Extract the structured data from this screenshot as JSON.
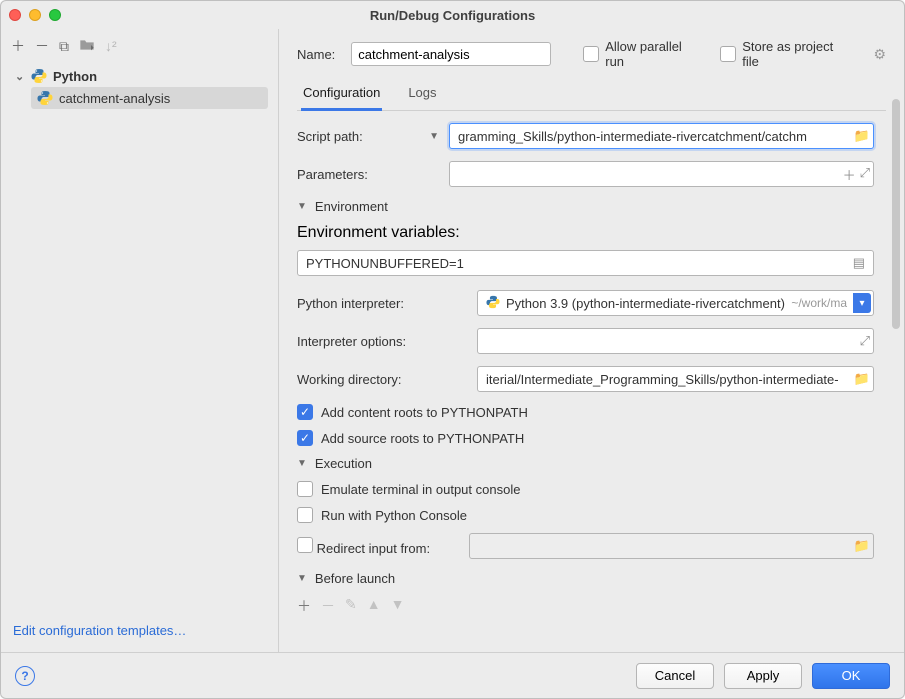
{
  "window": {
    "title": "Run/Debug Configurations"
  },
  "tree": {
    "root_label": "Python",
    "child_label": "catchment-analysis"
  },
  "left_footer": {
    "edit_templates": "Edit configuration templates…"
  },
  "header": {
    "name_label": "Name:",
    "name_value": "catchment-analysis",
    "allow_parallel": "Allow parallel run",
    "store_as_project": "Store as project file"
  },
  "tabs": {
    "configuration": "Configuration",
    "logs": "Logs"
  },
  "form": {
    "script_path_label": "Script path:",
    "script_path_value": "gramming_Skills/python-intermediate-rivercatchment/catchm",
    "parameters_label": "Parameters:",
    "parameters_value": "",
    "env_section": "Environment",
    "env_vars_label": "Environment variables:",
    "env_vars_value": "PYTHONUNBUFFERED=1",
    "interpreter_label": "Python interpreter:",
    "interpreter_value": "Python 3.9 (python-intermediate-rivercatchment)",
    "interpreter_hint": "~/work/ma",
    "interp_options_label": "Interpreter options:",
    "interp_options_value": "",
    "workdir_label": "Working directory:",
    "workdir_value": "iterial/Intermediate_Programming_Skills/python-intermediate-",
    "add_content_roots": "Add content roots to PYTHONPATH",
    "add_source_roots": "Add source roots to PYTHONPATH",
    "exec_section": "Execution",
    "emulate_terminal": "Emulate terminal in output console",
    "run_with_console": "Run with Python Console",
    "redirect_input": "Redirect input from:",
    "redirect_input_value": "",
    "before_launch": "Before launch"
  },
  "footer": {
    "cancel": "Cancel",
    "apply": "Apply",
    "ok": "OK"
  }
}
